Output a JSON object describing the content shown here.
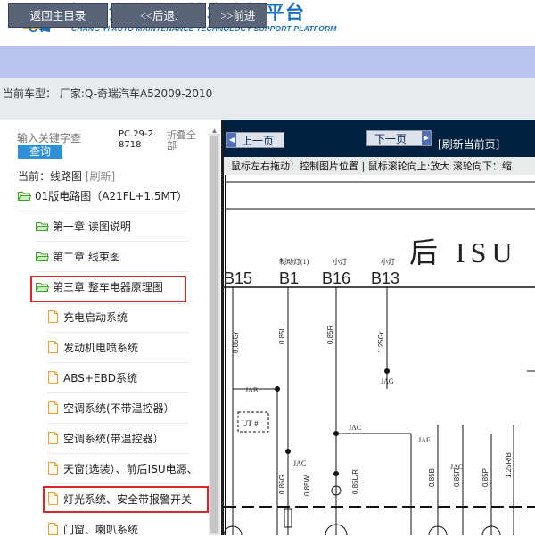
{
  "header": {
    "title_cn": "畅易汽车维修技术支持平台",
    "title_en": "CHANG YI AUTO MAINTENANCE TECHNOLOGY SUPPORT PLATFORM",
    "logo_icon": "cy-logo-icon"
  },
  "nav": {
    "home": "返回主目录",
    "back": "<<后退.",
    "forward": ">>前进"
  },
  "vehicle": {
    "text": "当前车型：  厂家:Q-奇瑞汽车A52009-2010"
  },
  "search": {
    "placeholder": "输入关键字查",
    "button": "查询",
    "pc_label": "PC.29-28718",
    "collapse": "折叠全部"
  },
  "tree": {
    "current_prefix": "当前：线路图",
    "refresh": "[刷新]",
    "root": "01版电路图（A21FL+1.5MT）",
    "chapters": [
      "第一章 读图说明",
      "第二章 线束图",
      "第三章 整车电器原理图"
    ],
    "docs": [
      "充电启动系统",
      "发动机电喷系统",
      "ABS+EBD系统",
      "空调系统(不带温控器）",
      "空调系统(带温控器）",
      "天窗(选装）、前后ISU电源、",
      "灯光系统、安全带报警开关",
      "门窗、喇叭系统"
    ]
  },
  "viewer": {
    "prev": "上一页",
    "next": "下一页",
    "refresh": "[刷新当前页]",
    "hint": "鼠标左右拖动：控制图片位置 | 鼠标滚轮向上:放大  滚轮向下：缩"
  },
  "diagram": {
    "heading": "后 ISU",
    "connector_labels": [
      "B15",
      "B1",
      "B16",
      "B13"
    ],
    "small_labels": [
      "制动灯(1)",
      "小灯",
      "小灯"
    ],
    "wire_labels": [
      "0.85Gr",
      "0.85L",
      "0.85R",
      "1.25Gr",
      "0.85G",
      "0.85L/R",
      "0.85W",
      "0.85B",
      "0.85R",
      "0.85P",
      "1.25R/B"
    ],
    "junction_labels": [
      "JAB",
      "JAG",
      "JAC",
      "JAC",
      "JAC",
      "JAE"
    ],
    "box_label": "UT #"
  },
  "colors": {
    "brand_blue": "#1c6fb8",
    "nav_bar": "#b9c5ec",
    "nav_button": "#5a6478",
    "toolbar": "#00203f",
    "highlight": "#e0252a",
    "folder_green": "#3ea52a"
  }
}
